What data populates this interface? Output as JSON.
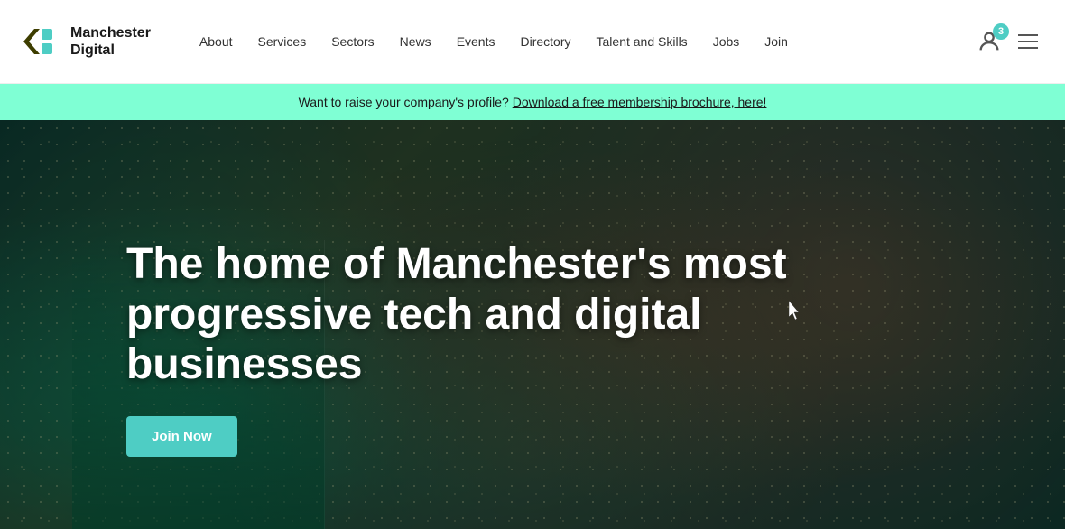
{
  "header": {
    "logo_text_line1": "Manchester",
    "logo_text_line2": "Digital",
    "nav_items": [
      {
        "label": "About",
        "id": "about"
      },
      {
        "label": "Services",
        "id": "services"
      },
      {
        "label": "Sectors",
        "id": "sectors"
      },
      {
        "label": "News",
        "id": "news"
      },
      {
        "label": "Events",
        "id": "events"
      },
      {
        "label": "Directory",
        "id": "directory"
      },
      {
        "label": "Talent and Skills",
        "id": "talent-and-skills"
      },
      {
        "label": "Jobs",
        "id": "jobs"
      },
      {
        "label": "Join",
        "id": "join"
      }
    ],
    "notification_count": "3"
  },
  "announcement": {
    "text": "Want to raise your company's profile?",
    "link_text": "Download a free membership brochure, here!"
  },
  "hero": {
    "title": "The home of Manchester's most progressive tech and digital businesses",
    "cta_label": "Join Now"
  }
}
